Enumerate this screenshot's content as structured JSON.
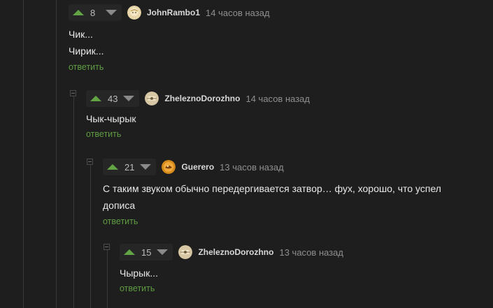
{
  "comments": [
    {
      "score": "8",
      "username": "JohnRambo1",
      "time": "14 часов назад",
      "lines": [
        "Чик...",
        "Чирик..."
      ],
      "reply_label": "ответить"
    },
    {
      "score": "43",
      "username": "ZheleznoDorozhno",
      "time": "14 часов назад",
      "lines": [
        "Чык-чырык"
      ],
      "reply_label": "ответить"
    },
    {
      "score": "21",
      "username": "Guerero",
      "time": "13 часов назад",
      "lines": [
        "С таким звуком обычно передергивается затвор… фух, хорошо, что успел",
        "дописа"
      ],
      "reply_label": "ответить"
    },
    {
      "score": "15",
      "username": "ZheleznoDorozhno",
      "time": "13 часов назад",
      "lines": [
        "Чырык..."
      ],
      "reply_label": "ответить"
    }
  ],
  "colors": {
    "background": "#1e1e1e",
    "upvote": "#63a444",
    "reply_link": "#5f9c41",
    "thread_line": "#3a3a3a"
  },
  "icons": [
    "arrow-up-icon",
    "arrow-down-icon",
    "collapse-icon",
    "avatar"
  ]
}
